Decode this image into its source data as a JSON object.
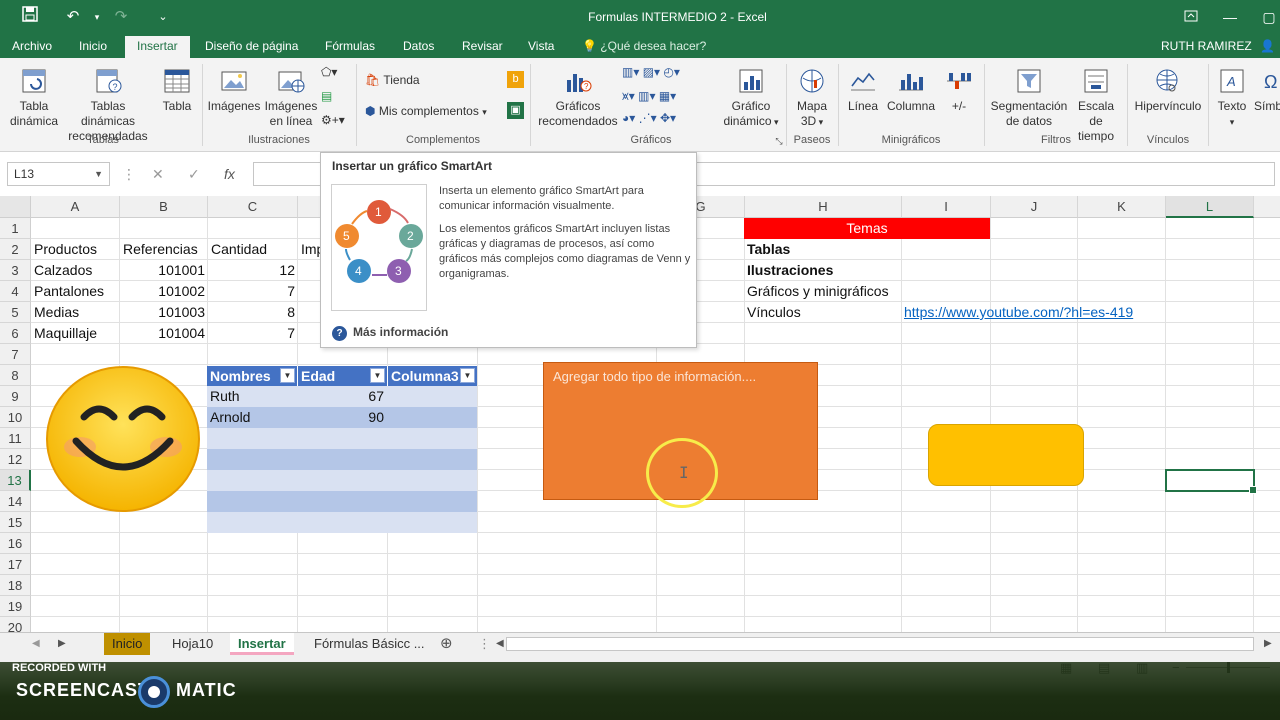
{
  "window": {
    "title": "Formulas INTERMEDIO 2 - Excel"
  },
  "tabs": {
    "archivo": "Archivo",
    "inicio": "Inicio",
    "insertar": "Insertar",
    "diseno": "Diseño de página",
    "formulas": "Fórmulas",
    "datos": "Datos",
    "revisar": "Revisar",
    "vista": "Vista",
    "tellme": "¿Qué desea hacer?",
    "user": "RUTH RAMIREZ"
  },
  "ribbon": {
    "tabla_dinamica": [
      "Tabla",
      "dinámica"
    ],
    "tablas_dinamicas_rec": [
      "Tablas dinámicas",
      "recomendadas"
    ],
    "tabla": "Tabla",
    "imagenes": "Imágenes",
    "imagenes_linea": [
      "Imágenes",
      "en línea"
    ],
    "tienda": "Tienda",
    "mis_complementos": "Mis complementos",
    "graficos_rec": [
      "Gráficos",
      "recomendados"
    ],
    "grafico_dinamico": [
      "Gráfico",
      "dinámico"
    ],
    "mapa3d": [
      "Mapa",
      "3D"
    ],
    "linea": "Línea",
    "columna": "Columna",
    "masmenos": "+/-",
    "segmentacion": [
      "Segmentación",
      "de datos"
    ],
    "escala": [
      "Escala de",
      "tiempo"
    ],
    "hipervinculo": "Hipervínculo",
    "texto": "Texto",
    "simb": "Símb",
    "groups": {
      "tablas": "Tablas",
      "ilustraciones": "Ilustraciones",
      "complementos": "Complementos",
      "graficos": "Gráficos",
      "paseos": "Paseos",
      "minigraficos": "Minigráficos",
      "filtros": "Filtros",
      "vinculos": "Vínculos"
    }
  },
  "formula_bar": {
    "name_box": "L13",
    "fx": "fx"
  },
  "columns": [
    "A",
    "B",
    "C",
    "D",
    "E",
    "F",
    "G",
    "H",
    "I",
    "J",
    "K",
    "L"
  ],
  "rows": [
    "1",
    "2",
    "3",
    "4",
    "5",
    "6",
    "7",
    "8",
    "9",
    "10",
    "11",
    "12",
    "13",
    "14",
    "15",
    "16",
    "17",
    "18",
    "19",
    "20"
  ],
  "cells": {
    "A2": "Productos",
    "B2": "Referencias",
    "C2": "Cantidad",
    "D2": "Imp",
    "A3": "Calzados",
    "B3": "101001",
    "C3": "12",
    "A4": "Pantalones",
    "B4": "101002",
    "C4": "7",
    "A5": "Medias",
    "B5": "101003",
    "C5": "8",
    "A6": "Maquillaje",
    "B6": "101004",
    "C6": "7",
    "H1": "Temas",
    "H2": "Tablas",
    "H3": "Ilustraciones",
    "H4": "Gráficos y minigráficos",
    "H5": "Vínculos",
    "I5": "https://www.youtube.com/?hl=es-419"
  },
  "table": {
    "headers": [
      "Nombres",
      "Edad",
      "Columna3"
    ],
    "rows": [
      [
        "Ruth",
        "67",
        ""
      ],
      [
        "Arnold",
        "90",
        ""
      ]
    ]
  },
  "shapes": {
    "orange_text": "Agregar todo tipo de información...."
  },
  "tooltip": {
    "title": "Insertar un gráfico SmartArt",
    "p1": "Inserta un elemento gráfico SmartArt para comunicar información visualmente.",
    "p2": "Los elementos gráficos SmartArt incluyen listas gráficas y diagramas de procesos, así como gráficos más complejos como diagramas de Venn y organigramas.",
    "more": "Más información",
    "cycle": [
      "1",
      "2",
      "3",
      "4",
      "5"
    ]
  },
  "sheets": {
    "inicio": "Inicio",
    "hoja10": "Hoja10",
    "insertar": "Insertar",
    "basicas": "Fórmulas Básicc ..."
  },
  "watermark": {
    "small": "RECORDED WITH",
    "big_left": "SCREENCAST",
    "big_right": "MATIC"
  },
  "colors": {
    "excel_green": "#217346",
    "table_blue": "#4472c4",
    "temas_red": "#ff0000",
    "orange": "#ed7d31",
    "yellow": "#ffc000"
  }
}
